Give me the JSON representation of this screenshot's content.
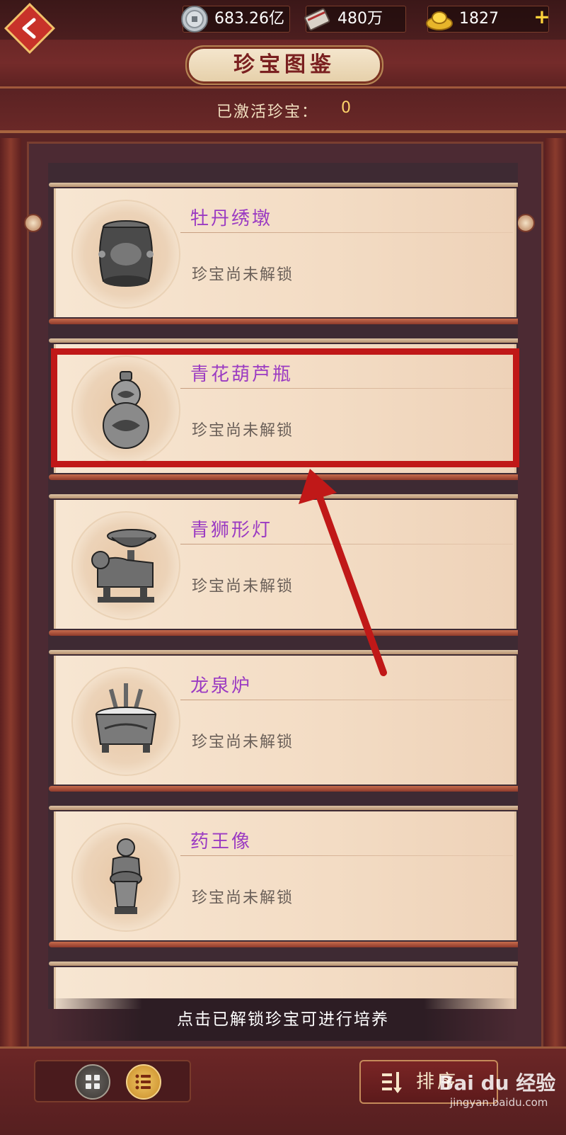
{
  "resources": {
    "silver": "683.26亿",
    "books": "480万",
    "gold": "1827",
    "add_label": "+"
  },
  "header": {
    "title": "珍宝图鉴",
    "activated_label": "已激活珍宝：",
    "activated_count": "0"
  },
  "treasures": [
    {
      "name": "牡丹绣墩",
      "status": "珍宝尚未解锁",
      "icon": "drum-stool-icon"
    },
    {
      "name": "青花葫芦瓶",
      "status": "珍宝尚未解锁",
      "icon": "gourd-vase-icon"
    },
    {
      "name": "青狮形灯",
      "status": "珍宝尚未解锁",
      "icon": "lion-lamp-icon"
    },
    {
      "name": "龙泉炉",
      "status": "珍宝尚未解锁",
      "icon": "censer-icon"
    },
    {
      "name": "药王像",
      "status": "珍宝尚未解锁",
      "icon": "statue-icon"
    }
  ],
  "hint": "点击已解锁珍宝可进行培养",
  "bottom": {
    "sort_label": "排序"
  },
  "watermark": {
    "main": "Bai du 经验",
    "sub": "jingyan.baidu.com"
  },
  "colors": {
    "accent_name": "#9b3bc2",
    "highlight": "#c01818",
    "gold": "#ffd46a"
  }
}
